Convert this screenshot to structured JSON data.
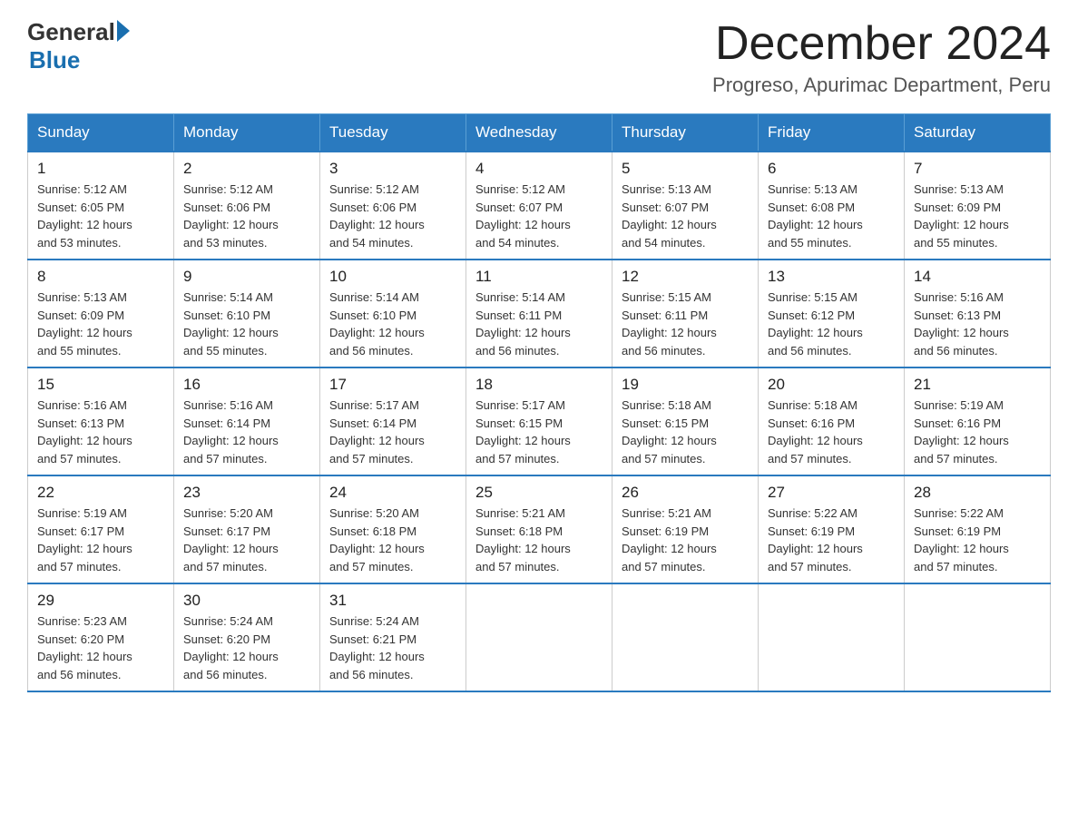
{
  "header": {
    "logo_general": "General",
    "logo_blue": "Blue",
    "month_title": "December 2024",
    "location": "Progreso, Apurimac Department, Peru"
  },
  "days_of_week": [
    "Sunday",
    "Monday",
    "Tuesday",
    "Wednesday",
    "Thursday",
    "Friday",
    "Saturday"
  ],
  "weeks": [
    [
      {
        "day": "1",
        "sunrise": "5:12 AM",
        "sunset": "6:05 PM",
        "daylight": "12 hours and 53 minutes."
      },
      {
        "day": "2",
        "sunrise": "5:12 AM",
        "sunset": "6:06 PM",
        "daylight": "12 hours and 53 minutes."
      },
      {
        "day": "3",
        "sunrise": "5:12 AM",
        "sunset": "6:06 PM",
        "daylight": "12 hours and 54 minutes."
      },
      {
        "day": "4",
        "sunrise": "5:12 AM",
        "sunset": "6:07 PM",
        "daylight": "12 hours and 54 minutes."
      },
      {
        "day": "5",
        "sunrise": "5:13 AM",
        "sunset": "6:07 PM",
        "daylight": "12 hours and 54 minutes."
      },
      {
        "day": "6",
        "sunrise": "5:13 AM",
        "sunset": "6:08 PM",
        "daylight": "12 hours and 55 minutes."
      },
      {
        "day": "7",
        "sunrise": "5:13 AM",
        "sunset": "6:09 PM",
        "daylight": "12 hours and 55 minutes."
      }
    ],
    [
      {
        "day": "8",
        "sunrise": "5:13 AM",
        "sunset": "6:09 PM",
        "daylight": "12 hours and 55 minutes."
      },
      {
        "day": "9",
        "sunrise": "5:14 AM",
        "sunset": "6:10 PM",
        "daylight": "12 hours and 55 minutes."
      },
      {
        "day": "10",
        "sunrise": "5:14 AM",
        "sunset": "6:10 PM",
        "daylight": "12 hours and 56 minutes."
      },
      {
        "day": "11",
        "sunrise": "5:14 AM",
        "sunset": "6:11 PM",
        "daylight": "12 hours and 56 minutes."
      },
      {
        "day": "12",
        "sunrise": "5:15 AM",
        "sunset": "6:11 PM",
        "daylight": "12 hours and 56 minutes."
      },
      {
        "day": "13",
        "sunrise": "5:15 AM",
        "sunset": "6:12 PM",
        "daylight": "12 hours and 56 minutes."
      },
      {
        "day": "14",
        "sunrise": "5:16 AM",
        "sunset": "6:13 PM",
        "daylight": "12 hours and 56 minutes."
      }
    ],
    [
      {
        "day": "15",
        "sunrise": "5:16 AM",
        "sunset": "6:13 PM",
        "daylight": "12 hours and 57 minutes."
      },
      {
        "day": "16",
        "sunrise": "5:16 AM",
        "sunset": "6:14 PM",
        "daylight": "12 hours and 57 minutes."
      },
      {
        "day": "17",
        "sunrise": "5:17 AM",
        "sunset": "6:14 PM",
        "daylight": "12 hours and 57 minutes."
      },
      {
        "day": "18",
        "sunrise": "5:17 AM",
        "sunset": "6:15 PM",
        "daylight": "12 hours and 57 minutes."
      },
      {
        "day": "19",
        "sunrise": "5:18 AM",
        "sunset": "6:15 PM",
        "daylight": "12 hours and 57 minutes."
      },
      {
        "day": "20",
        "sunrise": "5:18 AM",
        "sunset": "6:16 PM",
        "daylight": "12 hours and 57 minutes."
      },
      {
        "day": "21",
        "sunrise": "5:19 AM",
        "sunset": "6:16 PM",
        "daylight": "12 hours and 57 minutes."
      }
    ],
    [
      {
        "day": "22",
        "sunrise": "5:19 AM",
        "sunset": "6:17 PM",
        "daylight": "12 hours and 57 minutes."
      },
      {
        "day": "23",
        "sunrise": "5:20 AM",
        "sunset": "6:17 PM",
        "daylight": "12 hours and 57 minutes."
      },
      {
        "day": "24",
        "sunrise": "5:20 AM",
        "sunset": "6:18 PM",
        "daylight": "12 hours and 57 minutes."
      },
      {
        "day": "25",
        "sunrise": "5:21 AM",
        "sunset": "6:18 PM",
        "daylight": "12 hours and 57 minutes."
      },
      {
        "day": "26",
        "sunrise": "5:21 AM",
        "sunset": "6:19 PM",
        "daylight": "12 hours and 57 minutes."
      },
      {
        "day": "27",
        "sunrise": "5:22 AM",
        "sunset": "6:19 PM",
        "daylight": "12 hours and 57 minutes."
      },
      {
        "day": "28",
        "sunrise": "5:22 AM",
        "sunset": "6:19 PM",
        "daylight": "12 hours and 57 minutes."
      }
    ],
    [
      {
        "day": "29",
        "sunrise": "5:23 AM",
        "sunset": "6:20 PM",
        "daylight": "12 hours and 56 minutes."
      },
      {
        "day": "30",
        "sunrise": "5:24 AM",
        "sunset": "6:20 PM",
        "daylight": "12 hours and 56 minutes."
      },
      {
        "day": "31",
        "sunrise": "5:24 AM",
        "sunset": "6:21 PM",
        "daylight": "12 hours and 56 minutes."
      },
      null,
      null,
      null,
      null
    ]
  ],
  "labels": {
    "sunrise": "Sunrise:",
    "sunset": "Sunset:",
    "daylight": "Daylight:"
  }
}
